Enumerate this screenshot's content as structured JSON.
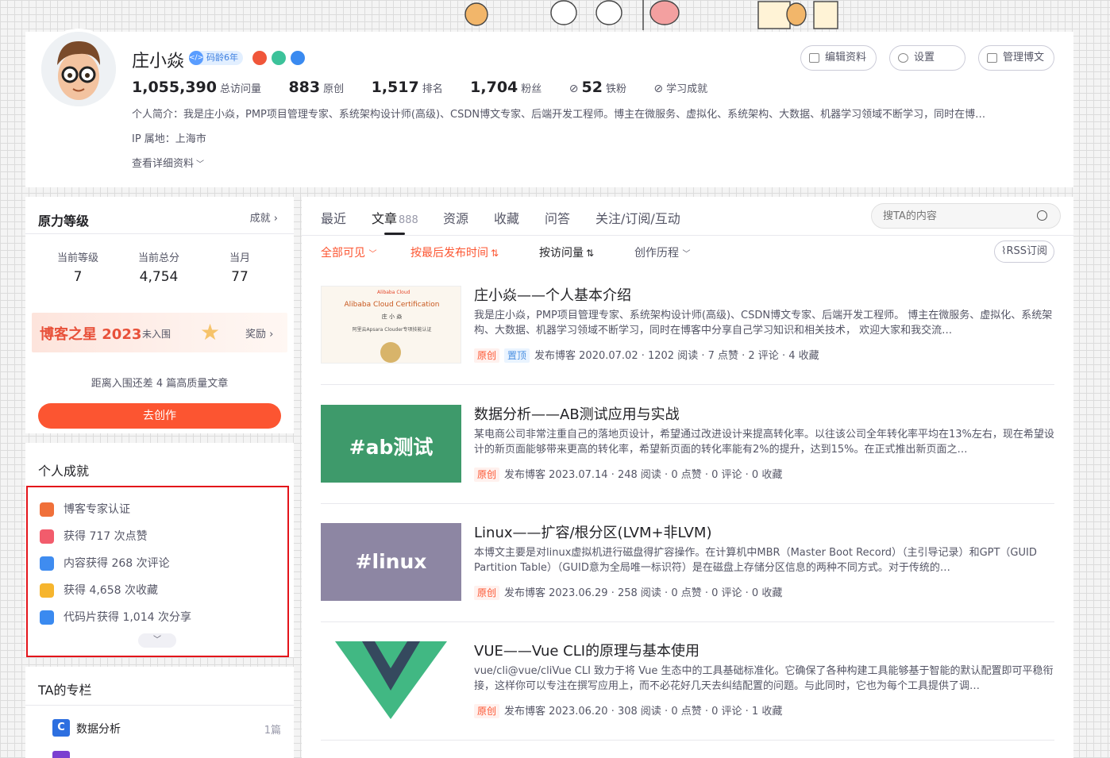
{
  "profile": {
    "name": "庄小焱",
    "code_age": "码龄6年",
    "buttons": {
      "edit": "编辑资料",
      "settings": "设置",
      "manage": "管理博文"
    },
    "stats": [
      {
        "value": "1,055,390",
        "label": "总访问量"
      },
      {
        "value": "883",
        "label": "原创"
      },
      {
        "value": "1,517",
        "label": "排名"
      },
      {
        "value": "1,704",
        "label": "粉丝"
      },
      {
        "value": "52",
        "label": "铁粉"
      }
    ],
    "learning": "学习成就",
    "bio": "个人简介：我是庄小焱，PMP项目管理专家、系统架构设计师(高级)、CSDN博文专家、后端开发工程师。博主在微服务、虚拟化、系统架构、大数据、机器学习领域不断学习，同时在博…",
    "ip": "IP 属地：上海市",
    "detail_link": "查看详细资料"
  },
  "level": {
    "title": "原力等级",
    "achievement_link": "成就",
    "cols": [
      {
        "label": "当前等级",
        "value": "7"
      },
      {
        "label": "当前总分",
        "value": "4,754"
      },
      {
        "label": "当月",
        "value": "77"
      }
    ],
    "star_title": "博客之星 2023",
    "star_status": "未入围",
    "reward": "奖励",
    "gap_text": "距离入围还差 4 篇高质量文章",
    "create_btn": "去创作"
  },
  "achievements": {
    "title": "个人成就",
    "items": [
      {
        "text": "博客专家认证",
        "color": "#f0703a"
      },
      {
        "text": "获得 717 次点赞",
        "color": "#f25c6c"
      },
      {
        "text": "内容获得 268 次评论",
        "color": "#3f8cf0"
      },
      {
        "text": "获得 4,658 次收藏",
        "color": "#f6b52e"
      },
      {
        "text": "代码片获得 1,014 次分享",
        "color": "#3a8af0"
      }
    ]
  },
  "columns": {
    "title": "TA的专栏",
    "items": [
      {
        "name": "数据分析",
        "count": "1篇"
      }
    ]
  },
  "tabs": {
    "items": [
      "最近",
      "文章",
      "资源",
      "收藏",
      "问答",
      "关注/订阅/互动"
    ],
    "article_count": "888",
    "search_placeholder": "搜TA的内容"
  },
  "filters": {
    "visible": "全部可见",
    "by_time": "按最后发布时间",
    "by_visits": "按访问量",
    "history": "创作历程",
    "rss": "RSS订阅"
  },
  "articles": [
    {
      "title": "庄小焱——个人基本介绍",
      "desc": "我是庄小焱，PMP项目管理专家、系统架构设计师(高级)、CSDN博文专家、后端开发工程师。 博主在微服务、虚拟化、系统架构、大数据、机器学习领域不断学习，同时在博客中分享自己学习知识和相关技术， 欢迎大家和我交流…",
      "tag1": "原创",
      "tag2": "置顶",
      "meta": "发布博客 2020.07.02 · 1202 阅读 · 7 点赞 · 2 评论 · 4 收藏",
      "thumb": {
        "brand": "Alibaba Cloud",
        "title": "Alibaba Cloud Certification",
        "name": "庄 小 焱",
        "sub": "阿里云Apsara Clouder专项技能认证"
      }
    },
    {
      "title": "数据分析——AB测试应用与实战",
      "desc": "某电商公司非常注重自己的落地页设计，希望通过改进设计来提高转化率。以往该公司全年转化率平均在13%左右，现在希望设计的新页面能够带来更高的转化率，希望新页面的转化率能有2%的提升，达到15%。在正式推出新页面之…",
      "tag1": "原创",
      "meta": "发布博客 2023.07.14 · 248 阅读 · 0 点赞 · 0 评论 · 0 收藏",
      "thumb_text": "#ab测试"
    },
    {
      "title": "Linux——扩容/根分区(LVM+非LVM)",
      "desc": "本博文主要是对linux虚拟机进行磁盘得扩容操作。在计算机中MBR（Master Boot Record）（主引导记录）和GPT（GUID Partition Table）（GUID意为全局唯一标识符）是在磁盘上存储分区信息的两种不同方式。对于传统的…",
      "tag1": "原创",
      "meta": "发布博客 2023.06.29 · 258 阅读 · 0 点赞 · 0 评论 · 0 收藏",
      "thumb_text": "#linux"
    },
    {
      "title": "VUE——Vue CLI的原理与基本使用",
      "desc": "vue/cli@vue/cliVue CLI 致力于将 Vue 生态中的工具基础标准化。它确保了各种构建工具能够基于智能的默认配置即可平稳衔接，这样你可以专注在撰写应用上，而不必花好几天去纠结配置的问题。与此同时，它也为每个工具提供了调…",
      "tag1": "原创",
      "meta": "发布博客 2023.06.20 · 308 阅读 · 0 点赞 · 0 评论 · 1 收藏"
    }
  ],
  "colors": {
    "accent": "#fc5531",
    "link_blue": "#4a90e2",
    "text": "#222226",
    "muted": "#555666"
  }
}
